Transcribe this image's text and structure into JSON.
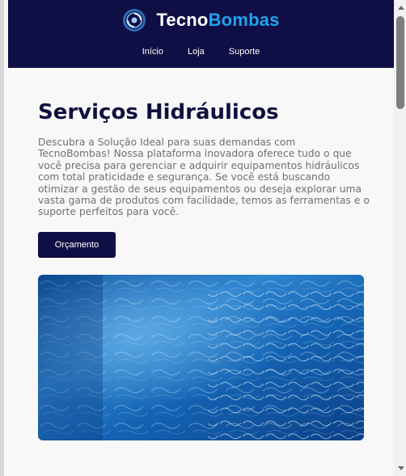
{
  "header": {
    "brand_part1": "Tecno",
    "brand_part2": "Bombas",
    "logo_icon": "pump-logo-icon",
    "nav": [
      {
        "label": "Início"
      },
      {
        "label": "Loja"
      },
      {
        "label": "Suporte"
      }
    ]
  },
  "main": {
    "title": "Serviços Hidráulicos",
    "description": "Descubra a Solução Ideal para suas demandas com TecnoBombas! Nossa plataforma inovadora oferece tudo o que você precisa para gerenciar e adquirir equipamentos hidráulicos com total praticidade e segurança. Se você está buscando otimizar a gestão de seus equipamentos ou deseja explorar uma vasta gama de produtos com facilidade, temos as ferramentas e o suporte perfeitos para você.",
    "cta_label": "Orçamento"
  },
  "colors": {
    "header_bg": "#0f0f45",
    "brand_accent": "#1fa3ee",
    "title": "#10103f",
    "body_text": "#6f7072"
  }
}
